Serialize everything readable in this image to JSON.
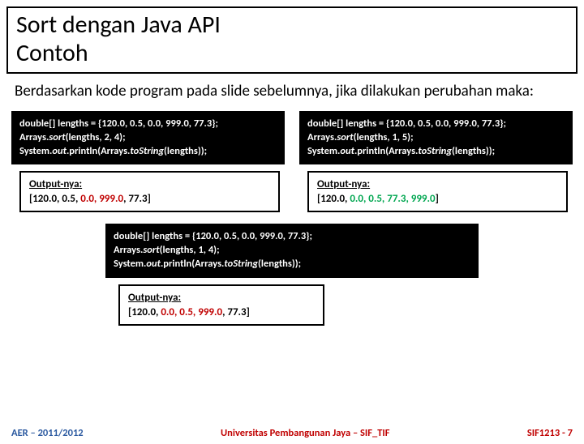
{
  "title": {
    "line1": "Sort dengan Java API",
    "line2": "Contoh"
  },
  "intro": "Berdasarkan kode program pada slide sebelumnya, jika dilakukan perubahan maka:",
  "left": {
    "code_l1": "double[] lengths = {120.0, 0.5, 0.0, 999.0, 77.3};",
    "code_l2a": "Arrays.",
    "code_l2b": "sort",
    "code_l2c": "(lengths, 2, 4);",
    "code_l3a": "System.",
    "code_l3b": "out",
    "code_l3c": ".println(Arrays.",
    "code_l3d": "toString",
    "code_l3e": "(lengths));",
    "out_label": "Output-nya:",
    "out_a": "[120.0, 0.5, ",
    "out_b": "0.0, 999.0",
    "out_c": ", 77.3]"
  },
  "right": {
    "code_l1": "double[] lengths = {120.0, 0.5, 0.0, 999.0, 77.3};",
    "code_l2a": "Arrays.",
    "code_l2b": "sort",
    "code_l2c": "(lengths, 1, 5);",
    "code_l3a": "System.",
    "code_l3b": "out",
    "code_l3c": ".println(Arrays.",
    "code_l3d": "toString",
    "code_l3e": "(lengths));",
    "out_label": "Output-nya:",
    "out_a": "[120.0, ",
    "out_b": "0.0, 0.5, 77.3, 999.0",
    "out_c": "]"
  },
  "bottom": {
    "code_l1": "double[] lengths = {120.0, 0.5, 0.0, 999.0, 77.3};",
    "code_l2a": "Arrays.",
    "code_l2b": "sort",
    "code_l2c": "(lengths, 1, 4);",
    "code_l3a": "System.",
    "code_l3b": "out",
    "code_l3c": ".println(Arrays.",
    "code_l3d": "toString",
    "code_l3e": "(lengths));",
    "out_label": "Output-nya:",
    "out_a": "[120.0, ",
    "out_b": "0.0, 0.5, 999.0",
    "out_c": ", 77.3]"
  },
  "footer": {
    "left": "AER – 2011/2012",
    "center": "Universitas Pembangunan Jaya – SIF_TIF",
    "right_a": "SIF1213 - ",
    "right_b": "7"
  }
}
